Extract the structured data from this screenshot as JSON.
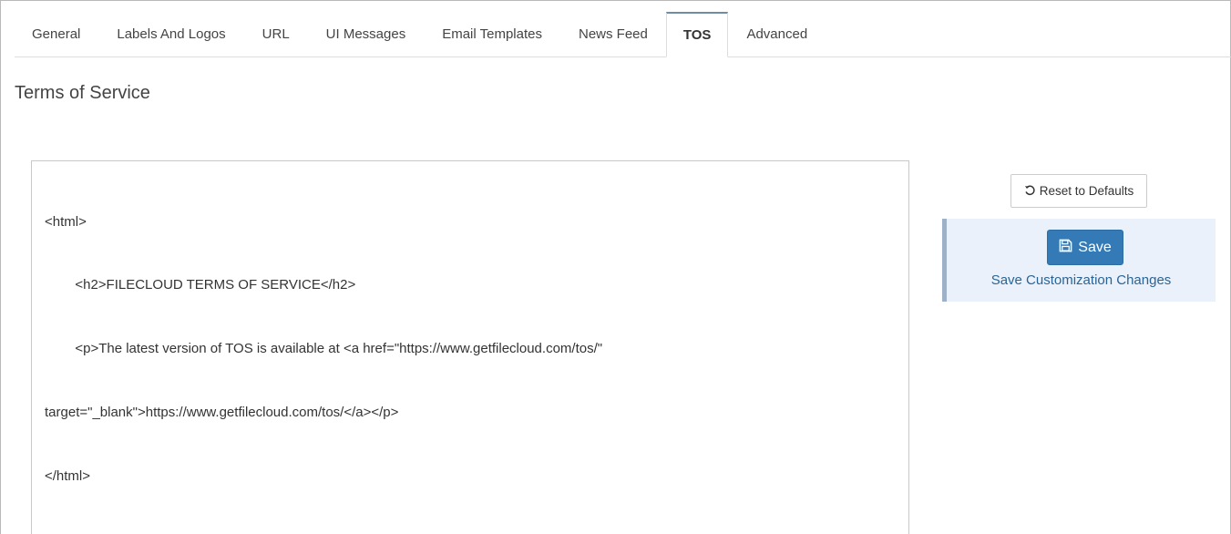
{
  "tabs": [
    {
      "label": "General"
    },
    {
      "label": "Labels And Logos"
    },
    {
      "label": "URL"
    },
    {
      "label": "UI Messages"
    },
    {
      "label": "Email Templates"
    },
    {
      "label": "News Feed"
    },
    {
      "label": "TOS",
      "active": true
    },
    {
      "label": "Advanced"
    }
  ],
  "page": {
    "title": "Terms of Service"
  },
  "editor": {
    "lines": [
      "<html>",
      "        <h2>FILECLOUD TERMS OF SERVICE</h2>",
      "        <p>The latest version of TOS is available at <a href=\"https://www.getfilecloud.com/tos/\"",
      "target=\"_blank\">https://www.getfilecloud.com/tos/</a></p>",
      "</html>"
    ]
  },
  "actions": {
    "reset_label": "Reset to Defaults",
    "save_label": "Save",
    "save_caption": "Save Customization Changes"
  },
  "icons": {
    "reset": "undo-icon",
    "save": "floppy-disk-icon"
  },
  "colors": {
    "accent": "#337ab7",
    "panel": "#eaf1fb",
    "active_tab_top": "#6f8ea6"
  }
}
